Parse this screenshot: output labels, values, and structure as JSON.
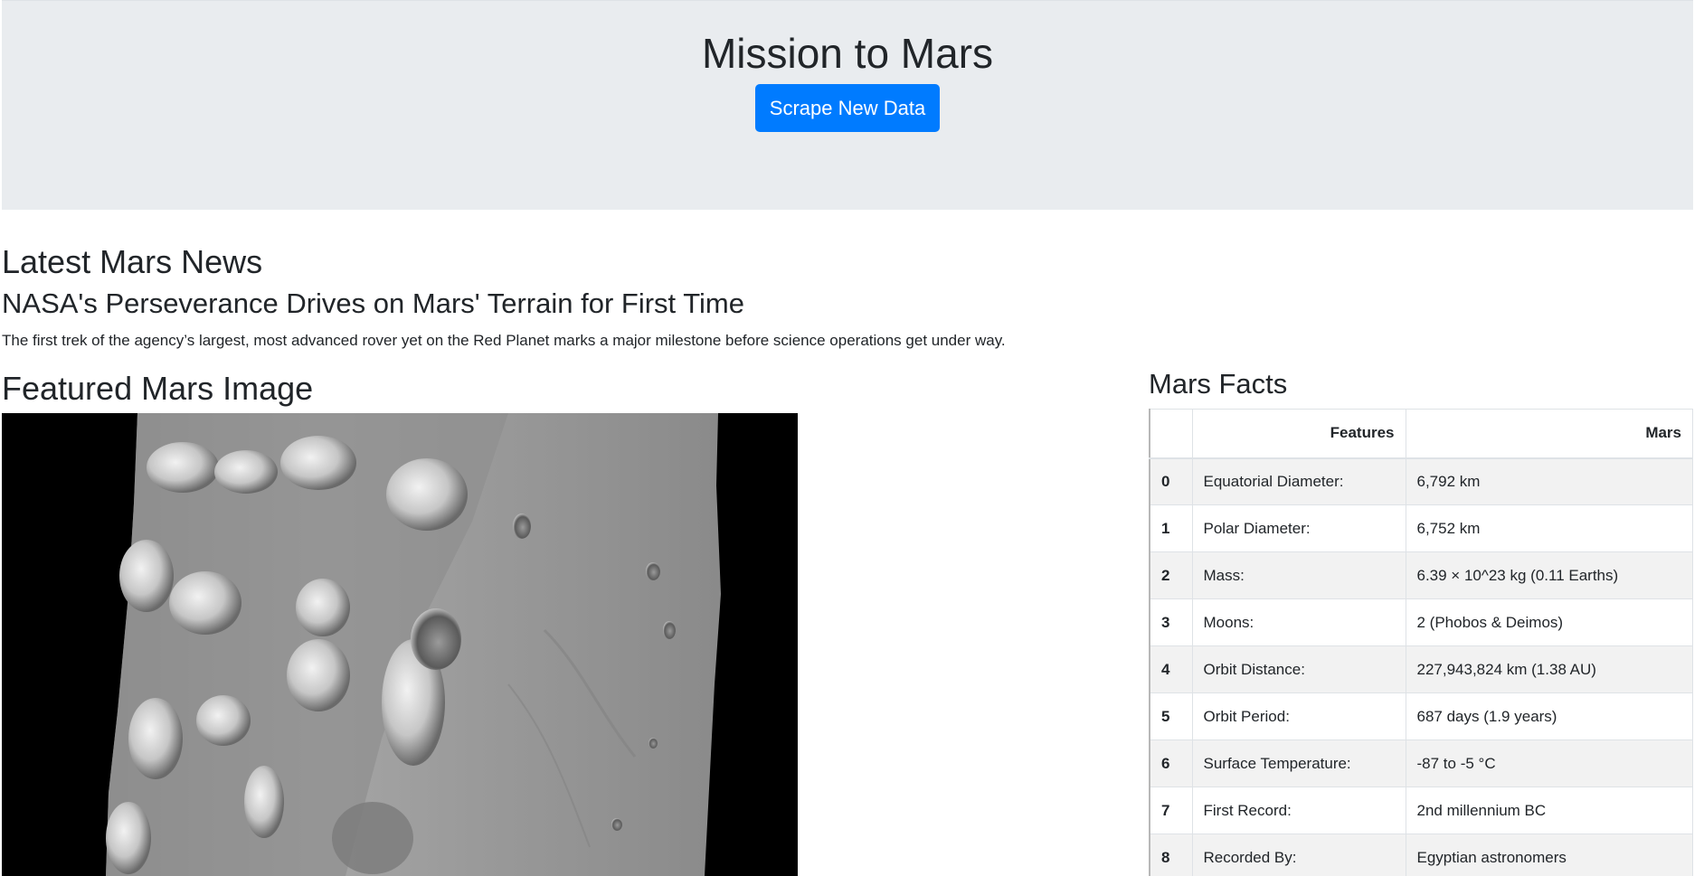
{
  "header": {
    "title": "Mission to Mars",
    "scrape_button_label": "Scrape New Data"
  },
  "news": {
    "section_heading": "Latest Mars News",
    "title": "NASA's Perseverance Drives on Mars' Terrain for First Time",
    "paragraph": "The first trek of the agency’s largest, most advanced rover yet on the Red Planet marks a major milestone before science operations get under way."
  },
  "featured_image": {
    "section_heading": "Featured Mars Image"
  },
  "facts": {
    "section_heading": "Mars Facts",
    "columns": [
      "",
      "Features",
      "Mars"
    ],
    "rows": [
      {
        "index": "0",
        "feature": "Equatorial Diameter:",
        "value": "6,792 km"
      },
      {
        "index": "1",
        "feature": "Polar Diameter:",
        "value": "6,752 km"
      },
      {
        "index": "2",
        "feature": "Mass:",
        "value": "6.39 × 10^23 kg (0.11 Earths)"
      },
      {
        "index": "3",
        "feature": "Moons:",
        "value": "2 (Phobos & Deimos)"
      },
      {
        "index": "4",
        "feature": "Orbit Distance:",
        "value": "227,943,824 km (1.38 AU)"
      },
      {
        "index": "5",
        "feature": "Orbit Period:",
        "value": "687 days (1.9 years)"
      },
      {
        "index": "6",
        "feature": "Surface Temperature:",
        "value": "-87 to -5 °C"
      },
      {
        "index": "7",
        "feature": "First Record:",
        "value": "2nd millennium BC"
      },
      {
        "index": "8",
        "feature": "Recorded By:",
        "value": "Egyptian astronomers"
      }
    ]
  },
  "colors": {
    "jumbotron_bg": "#e9ecef",
    "primary_button": "#007bff",
    "text": "#212529",
    "striped_row": "#f2f2f2"
  }
}
